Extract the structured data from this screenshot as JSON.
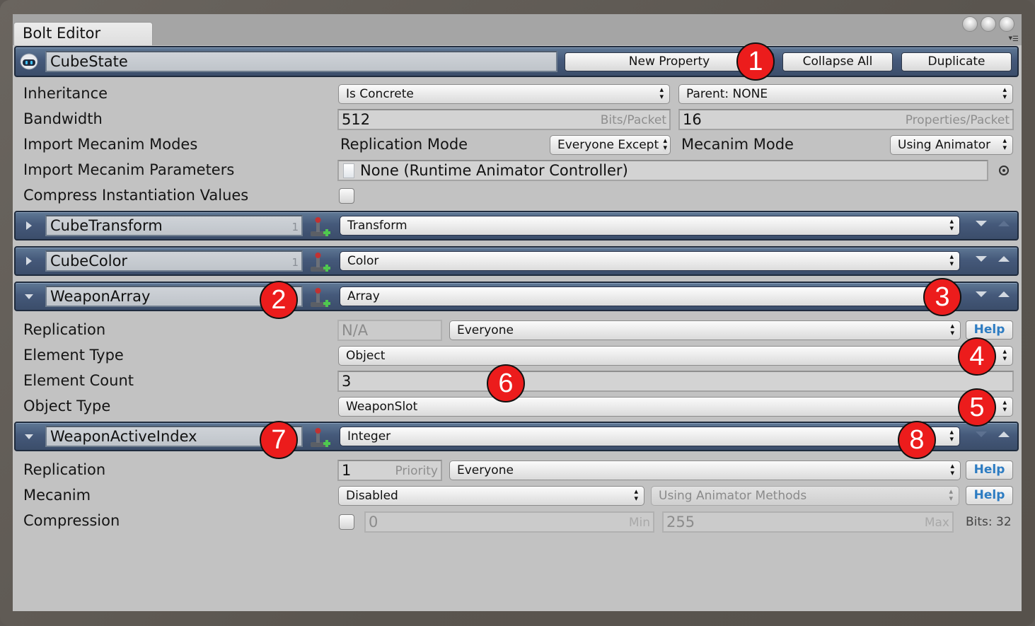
{
  "window": {
    "tab_title": "Bolt Editor"
  },
  "state": {
    "name": "CubeState",
    "buttons": {
      "new_property": "New Property",
      "collapse_all": "Collapse All",
      "duplicate": "Duplicate"
    },
    "rows": {
      "inheritance": {
        "label": "Inheritance",
        "concrete_select": "Is Concrete",
        "parent_select": "Parent: NONE"
      },
      "bandwidth": {
        "label": "Bandwidth",
        "bits_value": "512",
        "bits_suffix": "Bits/Packet",
        "props_value": "16",
        "props_suffix": "Properties/Packet"
      },
      "mecanim_modes": {
        "label": "Import Mecanim Modes",
        "replication_label": "Replication Mode",
        "replication_select": "Everyone Except",
        "mecanim_label": "Mecanim Mode",
        "mecanim_select": "Using Animator"
      },
      "mecanim_params": {
        "label": "Import Mecanim Parameters",
        "object_value": "None (Runtime Animator Controller)"
      },
      "compress": {
        "label": "Compress Instantiation Values",
        "checked": false
      }
    }
  },
  "properties": [
    {
      "name": "CubeTransform",
      "count": "1",
      "type": "Transform",
      "expanded": false,
      "can_move_up": false,
      "can_move_down": true
    },
    {
      "name": "CubeColor",
      "count": "1",
      "type": "Color",
      "expanded": false,
      "can_move_up": true,
      "can_move_down": true
    },
    {
      "name": "WeaponArray",
      "count": "",
      "type": "Array",
      "expanded": true,
      "can_move_up": true,
      "can_move_down": true,
      "rows": {
        "replication": {
          "label": "Replication",
          "priority_value": "N/A",
          "target_select": "Everyone",
          "help": "Help"
        },
        "element_type": {
          "label": "Element Type",
          "select": "Object"
        },
        "element_count": {
          "label": "Element Count",
          "value": "3"
        },
        "object_type": {
          "label": "Object Type",
          "select": "WeaponSlot"
        }
      }
    },
    {
      "name": "WeaponActiveIndex",
      "count": "",
      "type": "Integer",
      "expanded": true,
      "can_move_up": true,
      "can_move_down": false,
      "rows": {
        "replication": {
          "label": "Replication",
          "priority_value": "1",
          "priority_suffix": "Priority",
          "target_select": "Everyone",
          "help": "Help"
        },
        "mecanim": {
          "label": "Mecanim",
          "mode_select": "Disabled",
          "method_select": "Using Animator Methods",
          "help": "Help"
        },
        "compression": {
          "label": "Compression",
          "enabled": false,
          "min_value": "0",
          "min_suffix": "Min",
          "max_value": "255",
          "max_suffix": "Max",
          "bits": "Bits: 32"
        }
      }
    }
  ],
  "callouts": [
    "1",
    "2",
    "3",
    "4",
    "5",
    "6",
    "7",
    "8"
  ],
  "colors": {
    "header_blue": "#45597a",
    "help_text": "#2d7cc2",
    "callout_red": "#ec1c1c",
    "panel_bg": "#c2c2c2"
  }
}
